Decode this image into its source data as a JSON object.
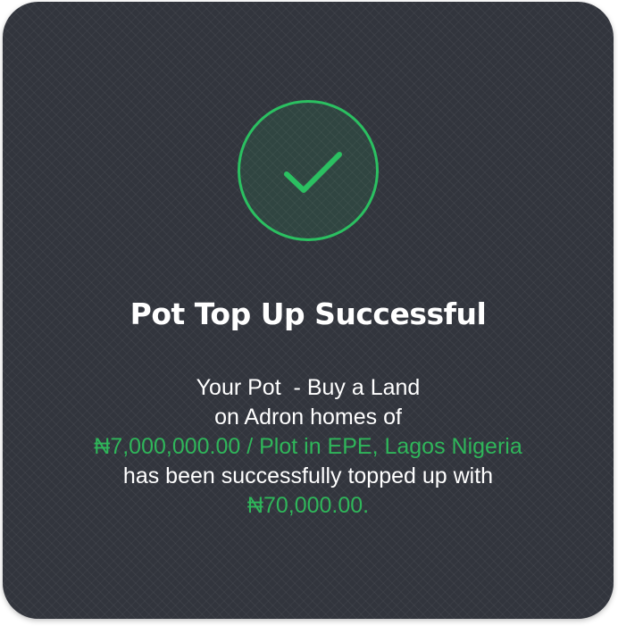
{
  "title": "Pot Top Up Successful",
  "message": {
    "line1": "Your Pot  - Buy a Land",
    "line2": "on Adron homes of",
    "line3_highlight": "₦7,000,000.00 / Plot in EPE, Lagos Nigeria",
    "line4": "has been successfully topped up with",
    "line5_highlight": "₦70,000.00."
  },
  "icon": "check-icon",
  "colors": {
    "accent": "#2bc061",
    "card_background": "#32353d",
    "text": "#ffffff"
  }
}
